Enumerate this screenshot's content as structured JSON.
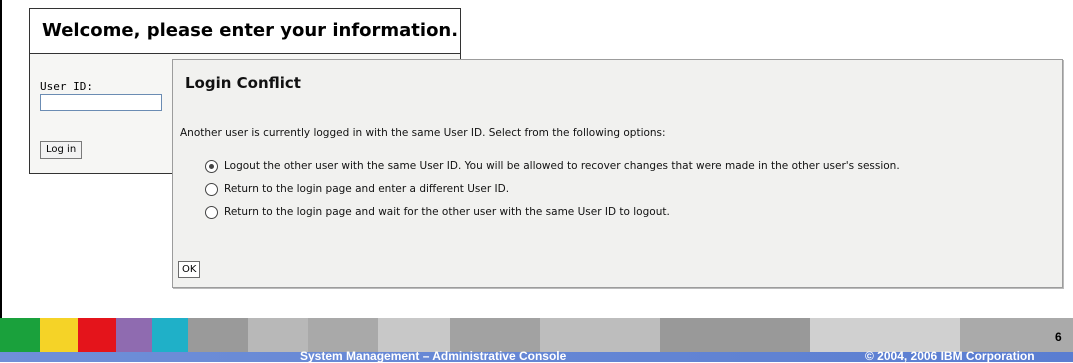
{
  "login": {
    "header": "Welcome, please enter your information.",
    "user_id_label": "User ID:",
    "user_id_value": "",
    "login_button": "Log in"
  },
  "conflict": {
    "title": "Login Conflict",
    "message": "Another user is currently logged in with the same User ID. Select from the following options:",
    "options": [
      {
        "label": "Logout the other user with the same User ID. You will be allowed to recover changes that were made in the other user's session.",
        "selected": true
      },
      {
        "label": "Return to the login page and enter a different User ID.",
        "selected": false
      },
      {
        "label": "Return to the login page and wait for the other user with the same User ID to logout.",
        "selected": false
      }
    ],
    "ok_button": "OK"
  },
  "footer": {
    "title": "System Management – Administrative Console",
    "copyright": "© 2004, 2006 IBM Corporation",
    "page_number": "6",
    "colors": [
      "#1aa13c",
      "#f5d327",
      "#e4141b",
      "#8f6bb0",
      "#1fb0c8",
      "#9a9a9a",
      "#b8b8b8",
      "#a9a9a9",
      "#c8c8c8",
      "#a2a2a2",
      "#bdbdbd",
      "#999999",
      "#d0d0d0",
      "#aaaaaa"
    ]
  }
}
